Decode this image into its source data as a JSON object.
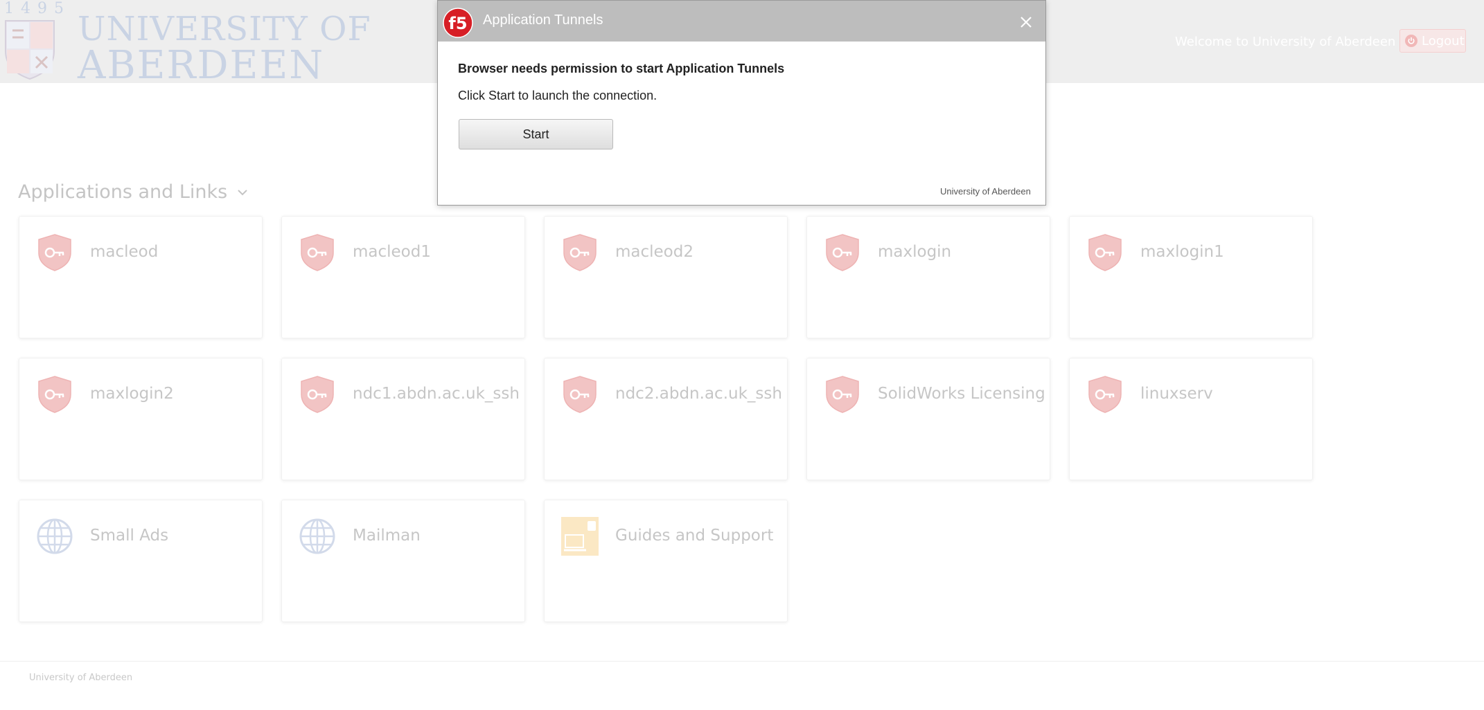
{
  "header": {
    "logo_year": "1495",
    "logo_line1": "UNIVERSITY OF",
    "logo_line2": "ABERDEEN",
    "welcome_text": "Welcome to University of Aberdeen",
    "logout_label": "Logout"
  },
  "section": {
    "title": "Applications and Links"
  },
  "tiles": [
    {
      "label": "macleod",
      "icon": "key-shield-icon"
    },
    {
      "label": "macleod1",
      "icon": "key-shield-icon"
    },
    {
      "label": "macleod2",
      "icon": "key-shield-icon"
    },
    {
      "label": "maxlogin",
      "icon": "key-shield-icon"
    },
    {
      "label": "maxlogin1",
      "icon": "key-shield-icon"
    },
    {
      "label": "maxlogin2",
      "icon": "key-shield-icon"
    },
    {
      "label": "ndc1.abdn.ac.uk_ssh",
      "icon": "key-shield-icon"
    },
    {
      "label": "ndc2.abdn.ac.uk_ssh",
      "icon": "key-shield-icon"
    },
    {
      "label": "SolidWorks Licensing",
      "icon": "key-shield-icon"
    },
    {
      "label": "linuxserv",
      "icon": "key-shield-icon"
    },
    {
      "label": "Small Ads",
      "icon": "globe-icon"
    },
    {
      "label": "Mailman",
      "icon": "globe-icon"
    },
    {
      "label": "Guides and Support",
      "icon": "guide-icon"
    }
  ],
  "footer": {
    "text": "University of Aberdeen"
  },
  "dialog": {
    "title": "Application Tunnels",
    "heading": "Browser needs permission to start Application Tunnels",
    "message": "Click Start to launch the connection.",
    "start_label": "Start",
    "footer_text": "University of Aberdeen"
  },
  "colors": {
    "header_bg": "#eeeeee",
    "dialog_bar": "#bdbdbd",
    "f5_red": "#d71f26",
    "logo_blue": "#c9d3e4",
    "shield_red": "#f2c4c4"
  }
}
